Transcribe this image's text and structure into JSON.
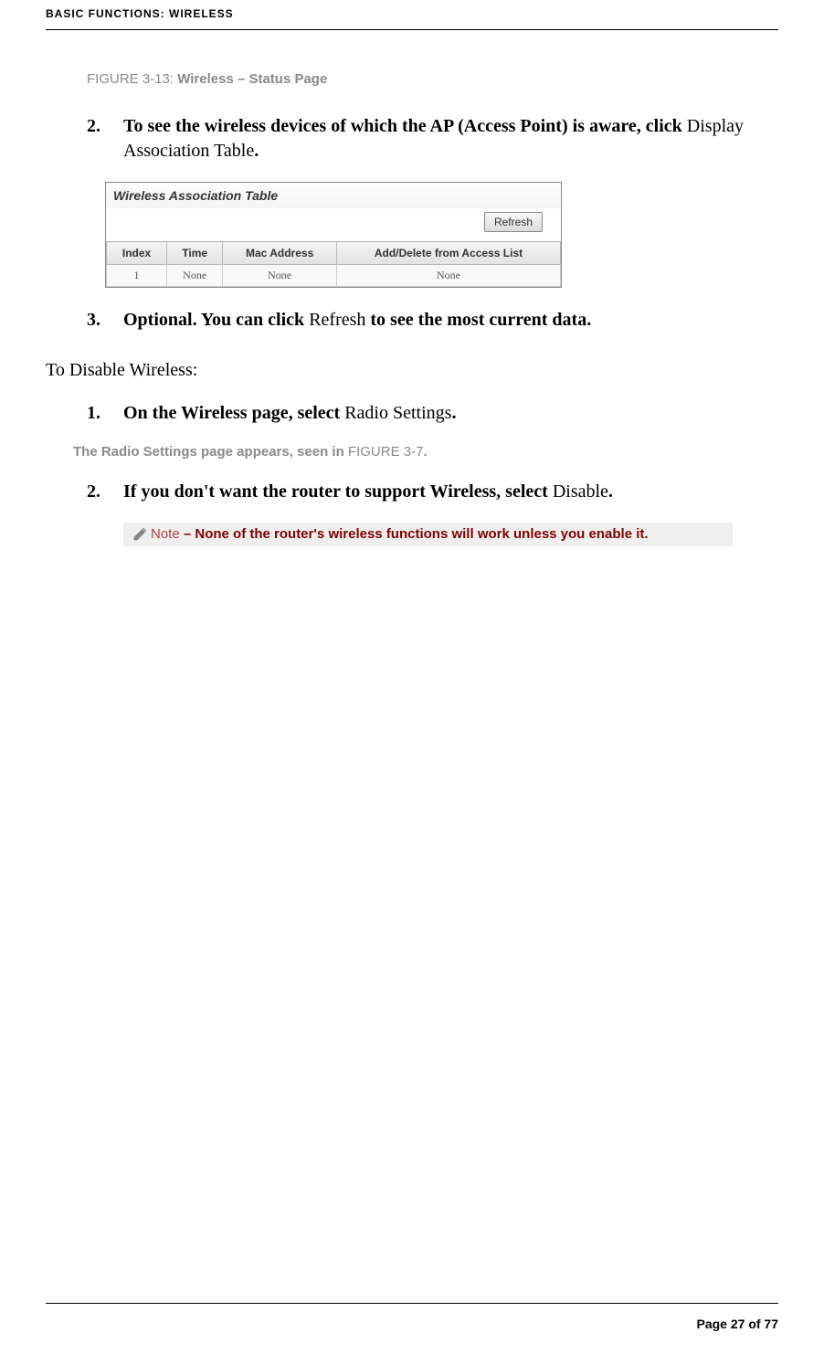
{
  "header": "BASIC FUNCTIONS: WIRELESS",
  "figure_caption": {
    "label": "FIGURE 3-13: ",
    "title": "Wireless – Status Page"
  },
  "step2": {
    "num": "2.",
    "bold1": "To see the wireless devices of which the AP (Access Point) is aware, click ",
    "plain": "Display Association Table",
    "bold2": "."
  },
  "assoc_table": {
    "title": "Wireless Association Table",
    "refresh_label": "Refresh",
    "headers": [
      "Index",
      "Time",
      "Mac Address",
      "Add/Delete from Access List"
    ],
    "row": [
      "1",
      "None",
      "None",
      "None"
    ]
  },
  "step3": {
    "num": "3.",
    "bold1": "Optional. You can click ",
    "plain": "Refresh",
    "bold2": " to see the most current data."
  },
  "disable_heading": "To Disable Wireless:",
  "dstep1": {
    "num": "1.",
    "bold1": "On the Wireless page, select ",
    "plain": "Radio Settings",
    "bold2": "."
  },
  "radio_note": {
    "text1": "The Radio Settings page appears, seen in ",
    "figref": "FIGURE 3-7",
    "text2": "."
  },
  "dstep2": {
    "num": "2.",
    "bold1": "If you don't want the router to support Wireless, select ",
    "plain": "Disable",
    "bold2": "."
  },
  "note_box": {
    "label": "Note",
    "text": " – None of the router's wireless functions will work unless you enable it."
  },
  "footer": "Page 27 of 77"
}
